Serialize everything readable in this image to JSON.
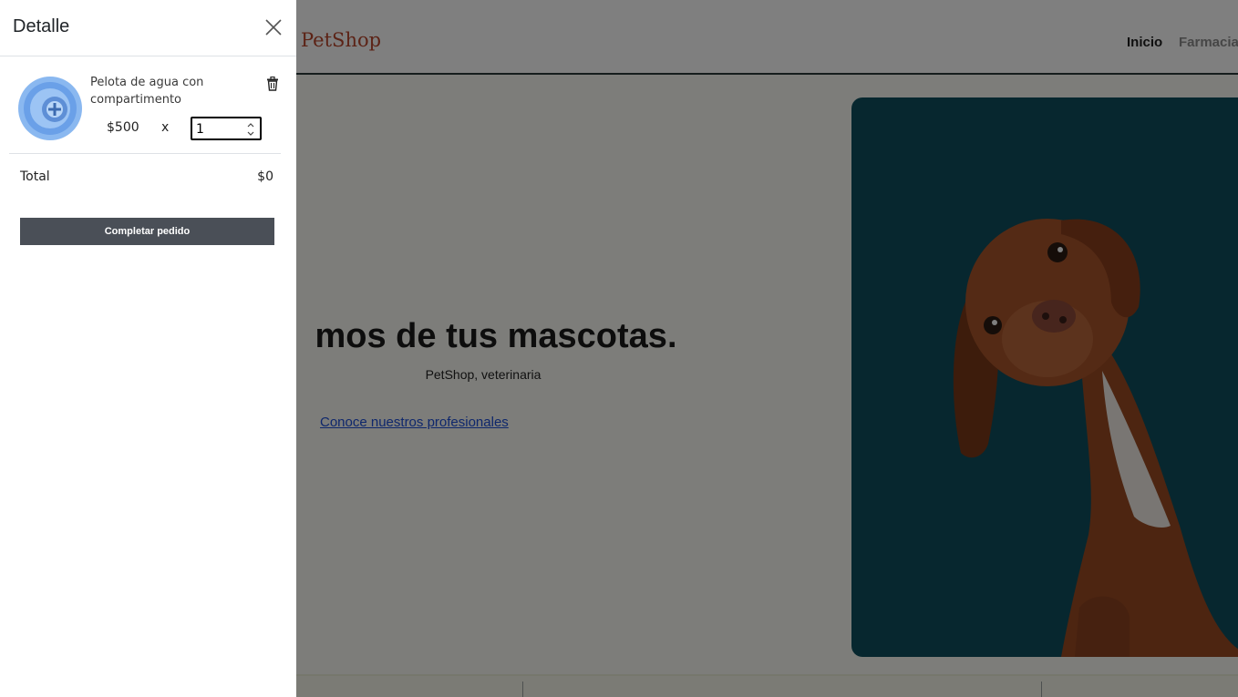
{
  "page": {
    "brand": "PetShop",
    "nav": {
      "inicio": "Inicio",
      "farmacia": "Farmacia"
    },
    "hero": {
      "heading": "mos de tus mascotas.",
      "subtitle": "PetShop, veterinaria",
      "link": "Conoce nuestros profesionales"
    }
  },
  "cart": {
    "title": "Detalle",
    "items": [
      {
        "name": "Pelota de agua con compartimento",
        "price": "$500",
        "multiplier": "x",
        "quantity": "1"
      }
    ],
    "total_label": "Total",
    "total_value": "$0",
    "checkout_label": "Completar pedido"
  },
  "icons": {
    "close": "close-icon",
    "trash": "trash-icon",
    "spinner": "spinner-arrows-icon"
  },
  "colors": {
    "brand": "#b8462c",
    "hero_bg": "#0f4f5e",
    "checkout_bg": "#4a4f57",
    "link": "#1d4ed8"
  }
}
